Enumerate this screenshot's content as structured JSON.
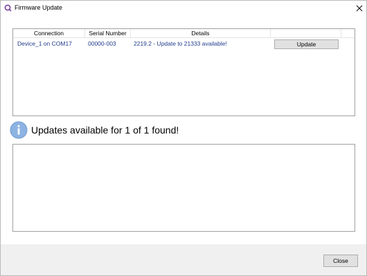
{
  "window": {
    "title": "Firmware Update",
    "icon": "app-ring-icon",
    "close_icon": "close-icon"
  },
  "grid": {
    "columns": [
      "Connection",
      "Serial Number",
      "Details",
      ""
    ],
    "rows": [
      {
        "connection": "Device_1  on  COM17",
        "serial": "00000-003",
        "details": "2219.2 - Update to 21333 available!",
        "action_label": "Update"
      }
    ]
  },
  "status": {
    "icon": "info-icon",
    "message": "Updates available for 1 of 1 found!"
  },
  "log": {
    "content": ""
  },
  "footer": {
    "close_label": "Close"
  },
  "colors": {
    "link_text": "#1f3b8c",
    "info_icon_fill": "#8db3e2",
    "app_icon": "#7a3fa0"
  }
}
